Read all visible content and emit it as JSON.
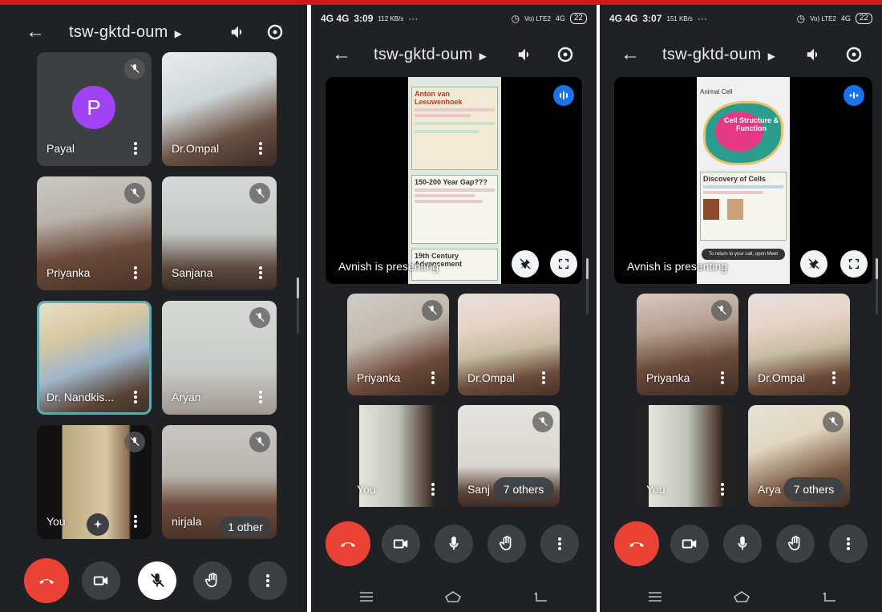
{
  "meeting": {
    "code": "tsw-gktd-oum"
  },
  "colors": {
    "end_call": "#ea4335",
    "avatar_payal": "#a142f4",
    "audio_indicator": "#1a73e8",
    "selected_outline": "#5fa9b5",
    "background": "#202124"
  },
  "panel1": {
    "participants": [
      {
        "name": "Payal",
        "avatar_letter": "P",
        "muted": true
      },
      {
        "name": "Dr.Ompal",
        "muted": false
      },
      {
        "name": "Priyanka",
        "muted": true
      },
      {
        "name": "Sanjana",
        "muted": true
      },
      {
        "name": "Dr. Nandkis...",
        "muted": false,
        "selected": true
      },
      {
        "name": "Aryan",
        "muted": true
      },
      {
        "name": "You",
        "muted": true
      },
      {
        "name": "nirjala",
        "muted": true
      }
    ],
    "overflow_pill": "1 other"
  },
  "panel2": {
    "status": {
      "network": "4G 4G",
      "time": "3:09",
      "speed": "112 KB/s",
      "extra": "···",
      "volte": "Vo) LTE2",
      "net2": "4G",
      "battery": "22"
    },
    "presenter_label": "Avnish is presenting",
    "slide": {
      "title1": "Anton van Leeuwenhoek",
      "title2": "150-200 Year Gap???",
      "title3": "19th Century Advancement"
    },
    "participants": [
      {
        "name": "Priyanka",
        "muted": true
      },
      {
        "name": "Dr.Ompal",
        "muted": false
      },
      {
        "name": "You",
        "muted": false
      },
      {
        "name": "Sanj",
        "muted": true
      }
    ],
    "overflow_pill": "7 others"
  },
  "panel3": {
    "status": {
      "network": "4G 4G",
      "time": "3:07",
      "speed": "151 KB/s",
      "extra": "···",
      "volte": "Vo) LTE2",
      "net2": "4G",
      "battery": "22"
    },
    "presenter_label": "Avnish is presenting",
    "slide": {
      "title1": "Animal Cell",
      "diagram_label": "Cell Structure & Function",
      "title2": "Discovery of Cells",
      "toast": "To return to your call, open Meet"
    },
    "participants": [
      {
        "name": "Priyanka",
        "muted": true
      },
      {
        "name": "Dr.Ompal",
        "muted": false
      },
      {
        "name": "You",
        "muted": false
      },
      {
        "name": "Arya",
        "muted": true
      }
    ],
    "overflow_pill": "7 others"
  }
}
